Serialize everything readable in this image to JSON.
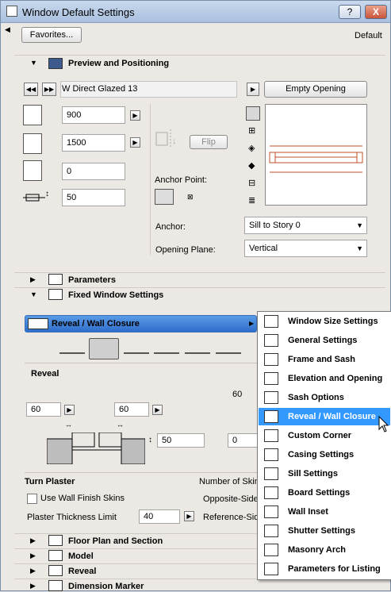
{
  "window": {
    "title": "Window Default Settings",
    "help_label": "?",
    "close_label": "X"
  },
  "top": {
    "favorites_label": "Favorites...",
    "default_label": "Default"
  },
  "preview_section": {
    "title": "Preview and Positioning",
    "object_name": "W Direct Glazed 13",
    "empty_opening_label": "Empty Opening",
    "width_value": "900",
    "height_value": "1500",
    "offset_value": "0",
    "sill_value": "50",
    "flip_label": "Flip",
    "anchor_point_label": "Anchor Point:",
    "anchor_label": "Anchor:",
    "anchor_value": "Sill to Story 0",
    "opening_plane_label": "Opening Plane:",
    "opening_plane_value": "Vertical"
  },
  "sections": {
    "parameters": "Parameters",
    "fixed_window_settings": "Fixed Window Settings",
    "floor_plan": "Floor Plan and Section",
    "model": "Model",
    "reveal": "Reveal",
    "dimension_marker": "Dimension Marker"
  },
  "fixed_window": {
    "selected_page": "Reveal / Wall Closure",
    "reveal_heading": "Reveal",
    "val_60_a": "60",
    "val_60_b": "60",
    "val_60_c": "60",
    "val_50": "50",
    "val_0": "0",
    "turn_plaster": "Turn Plaster",
    "use_wall_finish": "Use Wall Finish Skins",
    "plaster_thickness_label": "Plaster Thickness Limit",
    "plaster_thickness_value": "40",
    "number_of_skins": "Number of Skins",
    "opposite_side": "Opposite-Side",
    "reference_side": "Reference-Side"
  },
  "popup_menu": {
    "items": [
      {
        "label": "Window Size Settings",
        "icon": "window-size-icon",
        "selected": false
      },
      {
        "label": "General Settings",
        "icon": "general-settings-icon",
        "selected": false
      },
      {
        "label": "Frame and Sash",
        "icon": "frame-sash-icon",
        "selected": false
      },
      {
        "label": "Elevation and Opening",
        "icon": "elevation-icon",
        "selected": false
      },
      {
        "label": "Sash Options",
        "icon": "sash-options-icon",
        "selected": false
      },
      {
        "label": "Reveal / Wall Closure",
        "icon": "reveal-icon",
        "selected": true
      },
      {
        "label": "Custom Corner",
        "icon": "custom-corner-icon",
        "selected": false
      },
      {
        "label": "Casing Settings",
        "icon": "casing-icon",
        "selected": false
      },
      {
        "label": "Sill Settings",
        "icon": "sill-icon",
        "selected": false
      },
      {
        "label": "Board Settings",
        "icon": "board-icon",
        "selected": false
      },
      {
        "label": "Wall Inset",
        "icon": "wall-inset-icon",
        "selected": false
      },
      {
        "label": "Shutter Settings",
        "icon": "shutter-icon",
        "selected": false
      },
      {
        "label": "Masonry Arch",
        "icon": "masonry-arch-icon",
        "selected": false
      },
      {
        "label": "Parameters for Listing",
        "icon": "listing-icon",
        "selected": false
      }
    ]
  },
  "colors": {
    "selection": "#3399ff",
    "reveal_bar": "#2f6fcc",
    "preview_line": "#c0502a"
  }
}
